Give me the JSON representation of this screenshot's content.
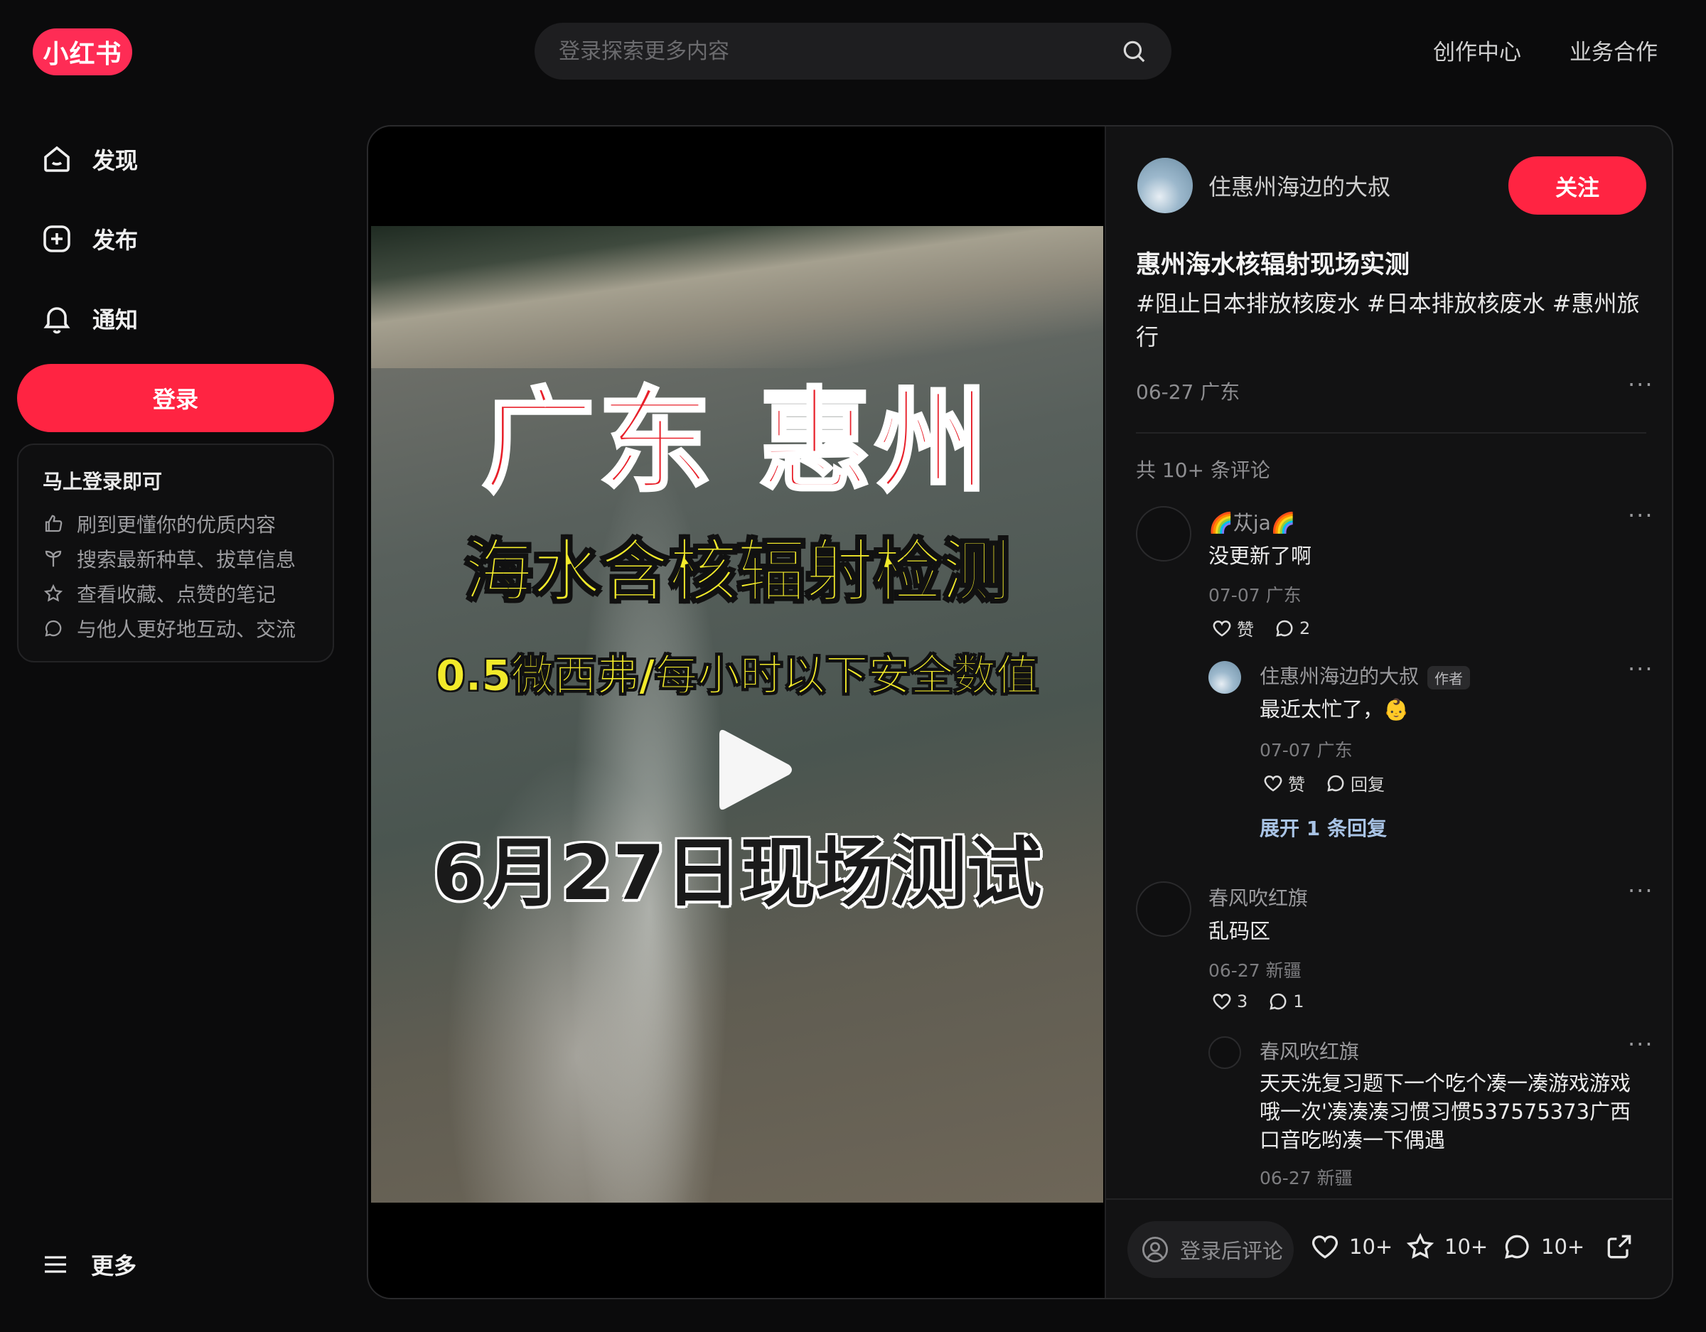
{
  "brand": {
    "logo_text": "小红书",
    "accent": "#ff2442"
  },
  "search": {
    "placeholder": "登录探索更多内容",
    "icon": "search-icon"
  },
  "top_links": [
    "创作中心",
    "业务合作"
  ],
  "sidebar": {
    "items": [
      {
        "label": "发现",
        "icon": "home-icon"
      },
      {
        "label": "发布",
        "icon": "plus-square-icon"
      },
      {
        "label": "通知",
        "icon": "bell-icon"
      }
    ],
    "login_label": "登录",
    "promo": {
      "title": "马上登录即可",
      "rows": [
        {
          "text": "刷到更懂你的优质内容",
          "icon": "thumbs-up-icon"
        },
        {
          "text": "搜索最新种草、拔草信息",
          "icon": "sprout-icon"
        },
        {
          "text": "查看收藏、点赞的笔记",
          "icon": "star-icon"
        },
        {
          "text": "与他人更好地互动、交流",
          "icon": "chat-bubble-icon"
        }
      ]
    },
    "more_label": "更多"
  },
  "video": {
    "overlay_line1": "广东  惠州",
    "overlay_line2": "海水含核辐射检测",
    "overlay_line3": "0.5微西弗/每小时以下安全数值",
    "overlay_line4": "6月27日现场测试"
  },
  "note": {
    "author": "住惠州海边的大叔",
    "follow_label": "关注",
    "title": "惠州海水核辐射现场实测",
    "tags": [
      "#阻止日本排放核废水",
      "#日本排放核废水",
      "#惠州旅行"
    ],
    "date_location": "06-27 广东",
    "comment_count": "共 10+ 条评论"
  },
  "comments": [
    {
      "name": "🌈苁ja🌈",
      "text": "没更新了啊",
      "date": "07-07 广东",
      "likes": "赞",
      "replies": "2",
      "reply": {
        "name": "住惠州海边的大叔",
        "badge": "作者",
        "text": "最近太忙了，👶",
        "date": "07-07 广东",
        "likes": "赞",
        "reply_label": "回复"
      },
      "expand_label": "展开 1 条回复"
    },
    {
      "name": "春风吹红旗",
      "text": "乱码区",
      "date": "06-27 新疆",
      "likes": "3",
      "replies": "1",
      "reply": {
        "name": "春风吹红旗",
        "text": "天天洗复习题下一个吃个凑一凑游戏游戏哦一次'凑凑凑习惯习惯537575373广西口音吃哟凑一下偶遇",
        "date": "06-27 新疆"
      }
    }
  ],
  "bottom_bar": {
    "comment_placeholder": "登录后评论",
    "likes": "10+",
    "collects": "10+",
    "comments": "10+"
  }
}
